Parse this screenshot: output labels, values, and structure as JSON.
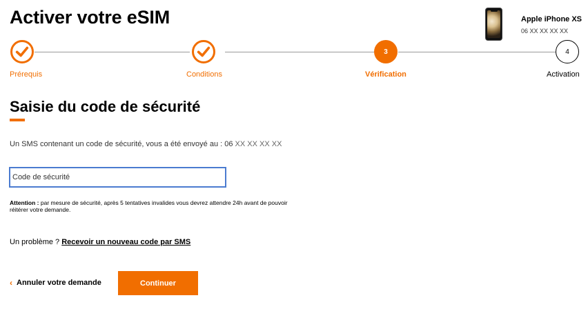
{
  "header": {
    "title": "Activer votre eSIM"
  },
  "device": {
    "icon": "iphone-image",
    "name": "Apple iPhone XS",
    "number": "06 XX XX XX XX"
  },
  "stepper": {
    "steps": [
      {
        "label": "Prérequis",
        "state": "done",
        "icon": "check-icon"
      },
      {
        "label": "Conditions",
        "state": "done",
        "icon": "check-icon"
      },
      {
        "label": "Vérification",
        "state": "active",
        "number": "3"
      },
      {
        "label": "Activation",
        "state": "todo",
        "number": "4"
      }
    ]
  },
  "main": {
    "title": "Saisie du code de sécurité",
    "sms_text": "Un SMS contenant un code de sécurité, vous a été envoyé au : 06 ",
    "sms_number": "XX XX XX XX",
    "code_input": {
      "placeholder": "Code de sécurité",
      "value": ""
    },
    "warning_label": "Attention :",
    "warning_text": " par mesure de sécurité, après 5 tentatives invalides vous devrez attendre 24h avant de pouvoir réitérer votre demande.",
    "problem_text": "Un problème ? ",
    "resend_link": "Recevoir un nouveau code par SMS"
  },
  "actions": {
    "cancel_chevron": "‹",
    "cancel_label": "Annuler votre demande",
    "continue_label": "Continuer"
  },
  "colors": {
    "accent": "#f16e00",
    "input_border": "#4a7bd0"
  }
}
